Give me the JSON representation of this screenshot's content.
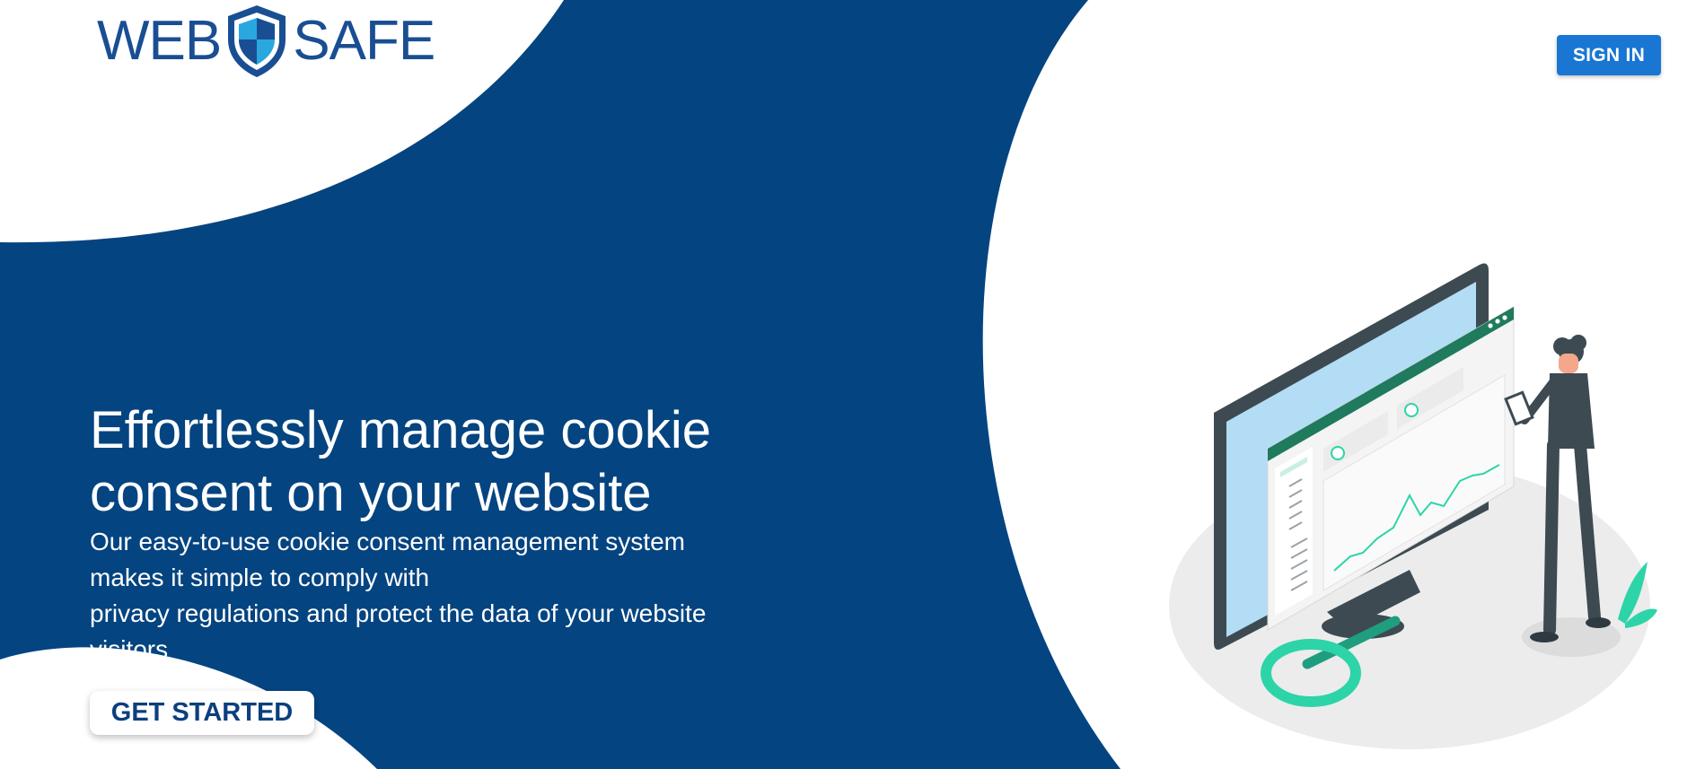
{
  "header": {
    "logo": {
      "text_left": "WEB",
      "text_right": "SAFE",
      "icon": "shield-icon"
    },
    "sign_in_label": "SIGN IN"
  },
  "hero": {
    "title_line1": "Effortlessly manage cookie",
    "title_line2": "consent on your website",
    "description": [
      "Our easy-to-use cookie consent management system",
      "makes it simple to comply with",
      "privacy regulations and protect the data of your website",
      "visitors"
    ],
    "cta_label": "GET STARTED"
  },
  "illustration": {
    "icon": "analytics-illustration"
  },
  "colors": {
    "primary_blue": "#044480",
    "button_blue": "#1976d2",
    "logo_blue": "#1a4e93",
    "accent_teal": "#2dd4a8",
    "white": "#ffffff"
  }
}
